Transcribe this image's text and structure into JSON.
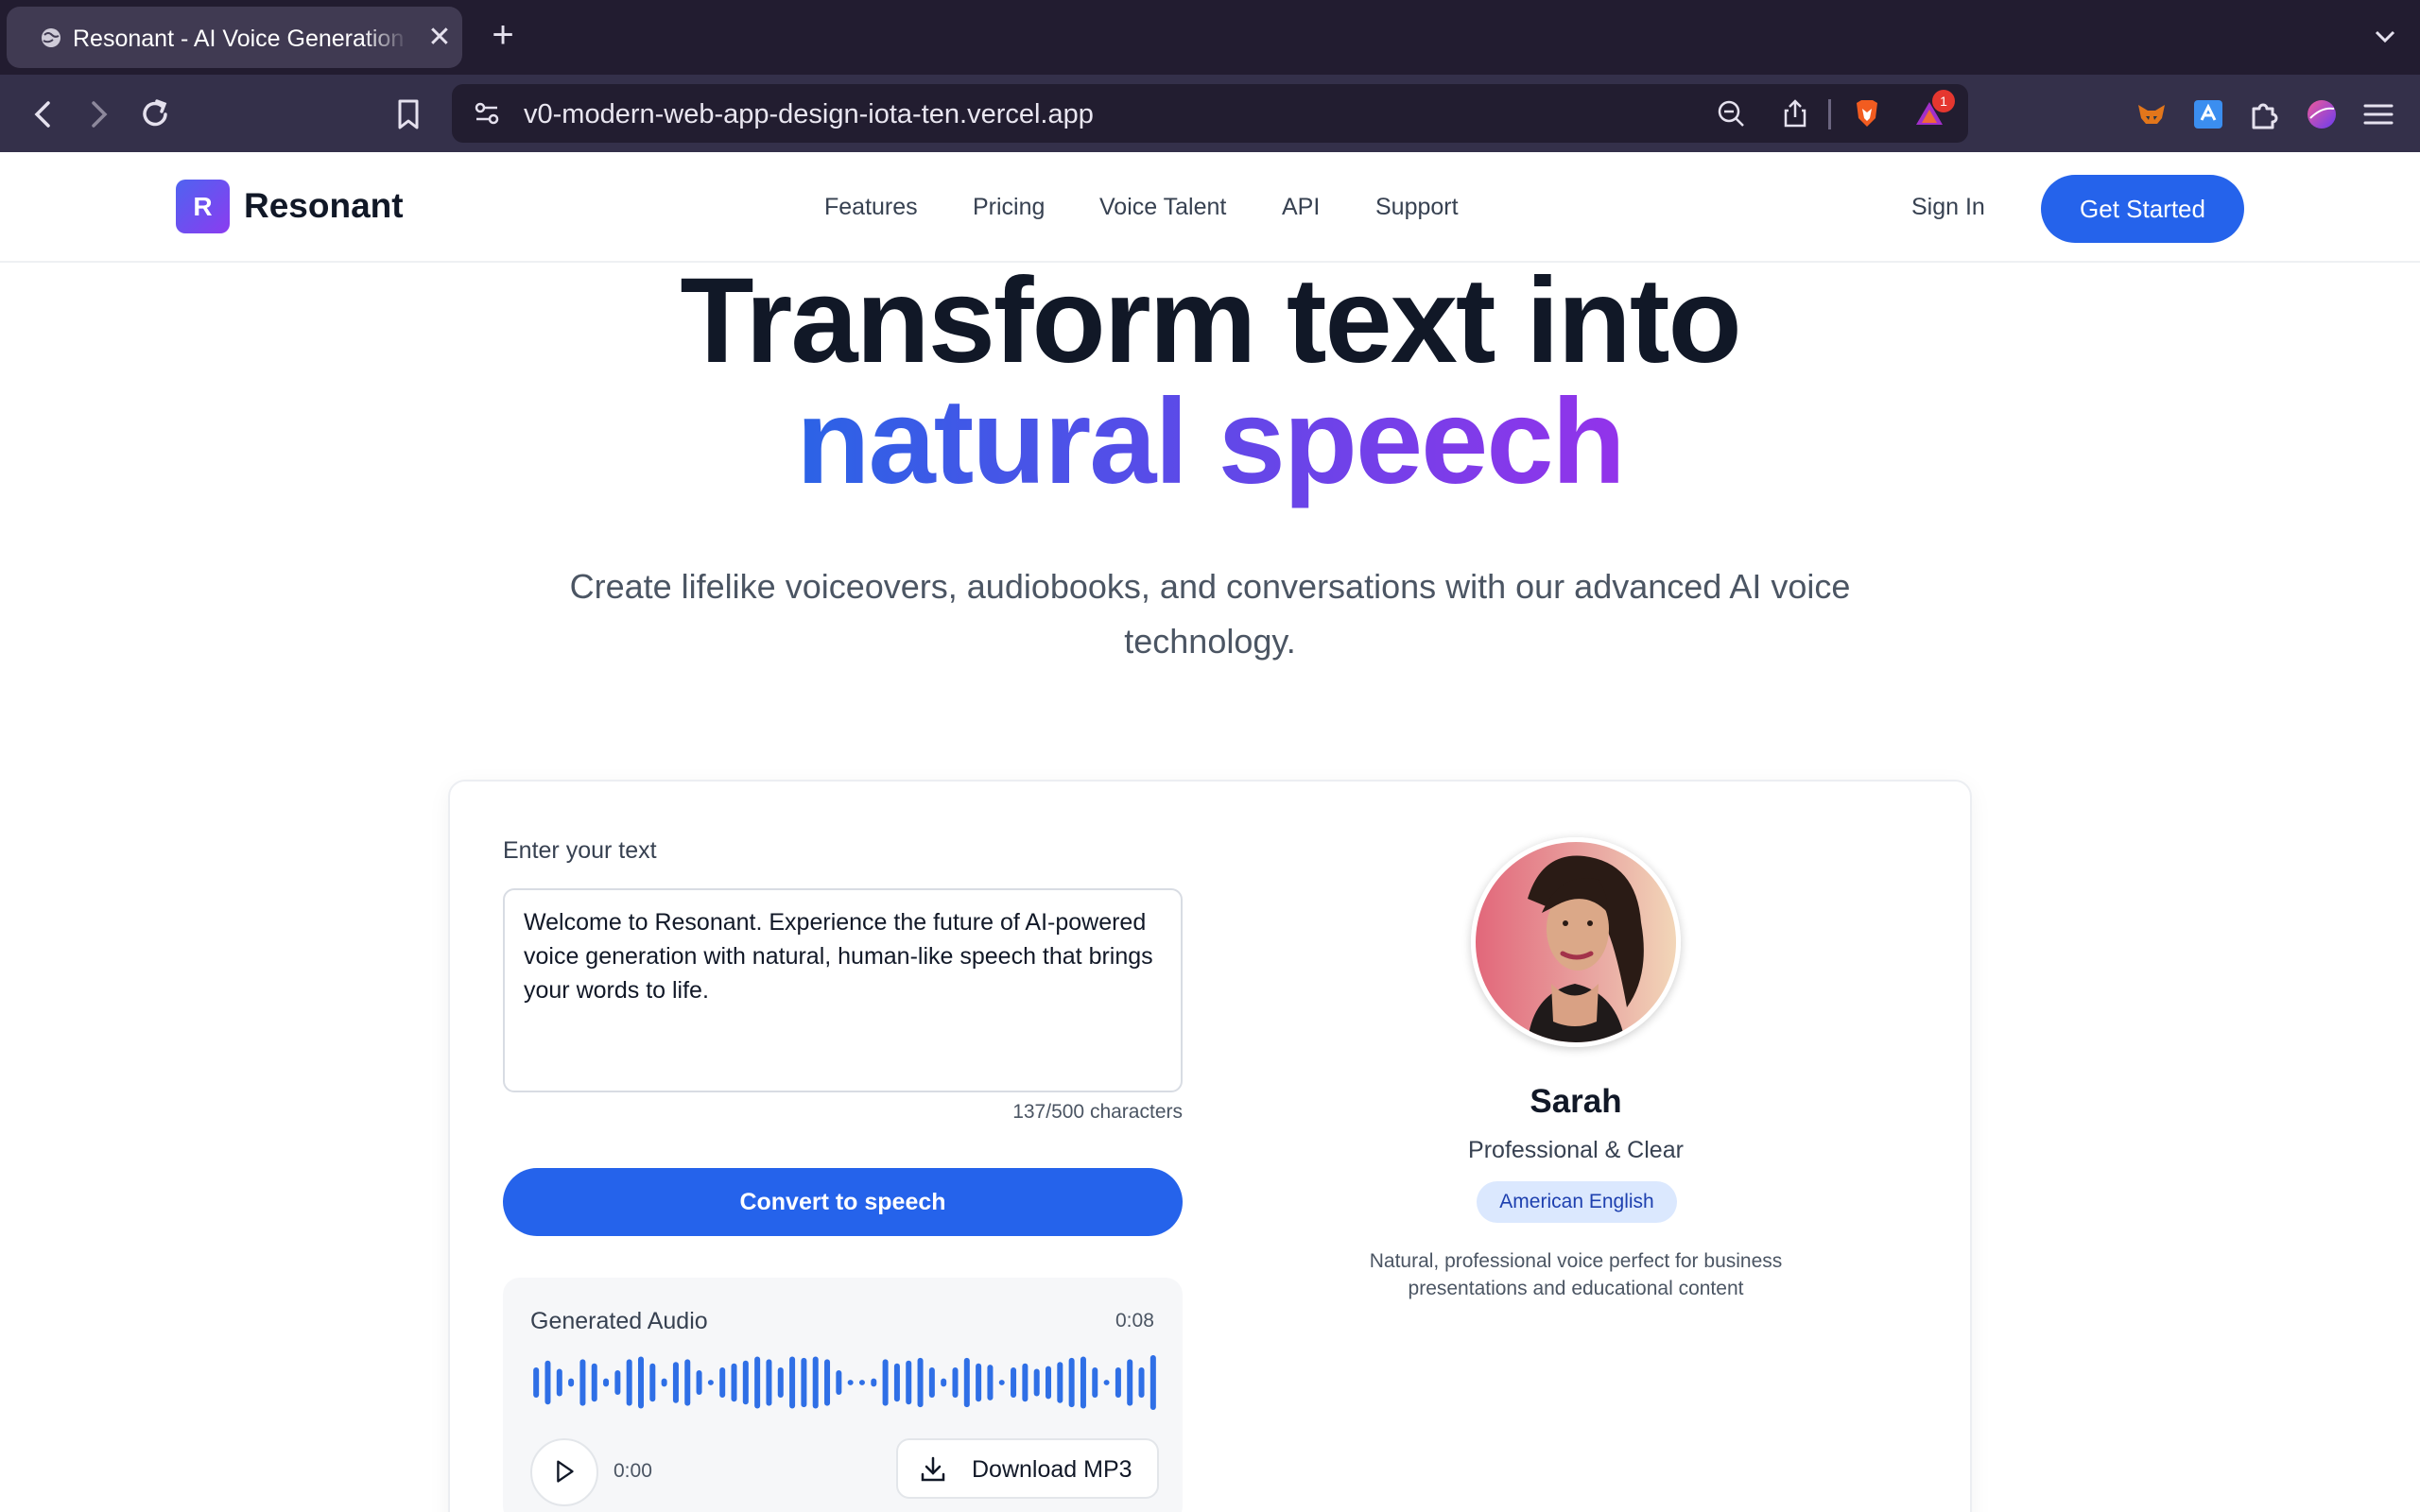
{
  "browser": {
    "tab_title": "Resonant - AI Voice Generation",
    "tab_close": "✕",
    "new_tab": "+",
    "url": "v0-modern-web-app-design-iota-ten.vercel.app",
    "notification_count": "1"
  },
  "header": {
    "logo_letter": "R",
    "brand": "Resonant",
    "nav": [
      "Features",
      "Pricing",
      "Voice Talent",
      "API",
      "Support"
    ],
    "sign_in": "Sign In",
    "get_started": "Get Started"
  },
  "hero": {
    "line1": "Transform text into",
    "line2": "natural speech",
    "subtitle": "Create lifelike voiceovers, audiobooks, and conversations with our advanced AI voice technology."
  },
  "editor": {
    "label": "Enter your text",
    "text": "Welcome to Resonant. Experience the future of AI-powered voice generation with natural, human-like speech that brings your words to life.",
    "char_count": "137/500 characters",
    "convert_label": "Convert to speech"
  },
  "audio": {
    "title": "Generated Audio",
    "duration": "0:08",
    "current_time": "0:00",
    "download_label": "Download MP3",
    "waveform": [
      0.55,
      0.8,
      0.5,
      0.15,
      0.85,
      0.7,
      0.15,
      0.45,
      0.85,
      0.95,
      0.7,
      0.15,
      0.75,
      0.85,
      0.45,
      0.1,
      0.55,
      0.7,
      0.8,
      0.95,
      0.85,
      0.55,
      0.95,
      0.9,
      0.95,
      0.85,
      0.45,
      0.1,
      0.1,
      0.15,
      0.85,
      0.7,
      0.8,
      0.9,
      0.55,
      0.15,
      0.55,
      0.9,
      0.7,
      0.65,
      0.1,
      0.55,
      0.7,
      0.5,
      0.6,
      0.75,
      0.9,
      0.95,
      0.55,
      0.1,
      0.55,
      0.85,
      0.55,
      1.0
    ],
    "colors": {
      "wave": "#2f6fe6"
    }
  },
  "voice": {
    "name": "Sarah",
    "style": "Professional & Clear",
    "accent": "American English",
    "description": "Natural, professional voice perfect for business presentations and educational content"
  },
  "icons": [
    "globe-icon",
    "close-icon",
    "plus-icon",
    "chevron-down-icon",
    "back-icon",
    "forward-icon",
    "reload-icon",
    "bookmark-icon",
    "site-settings-icon",
    "zoom-icon",
    "share-icon",
    "brave-shield-icon",
    "brave-rewards-icon",
    "metamask-icon",
    "extension-icon",
    "puzzle-icon",
    "profile-icon",
    "menu-icon",
    "play-icon",
    "download-icon"
  ],
  "colors": {
    "primary": "#2563eb",
    "gradient_start": "#2b63e6",
    "gradient_end": "#9333ea"
  }
}
